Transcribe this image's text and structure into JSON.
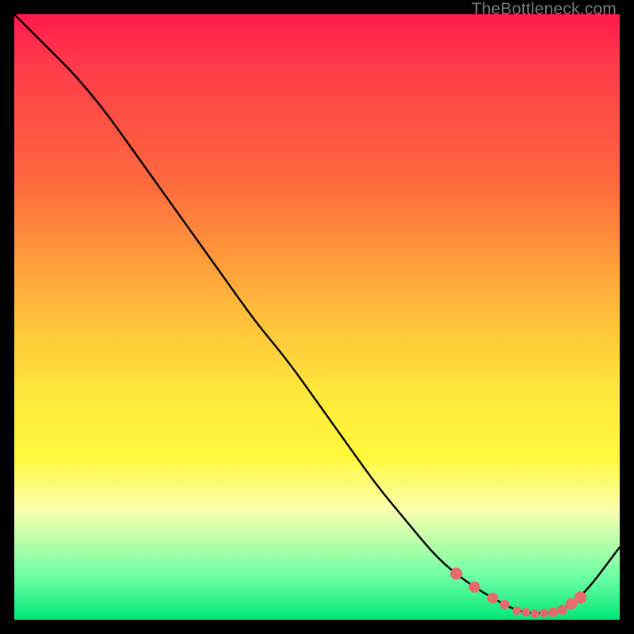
{
  "watermark": "TheBottleneck.com",
  "chart_data": {
    "type": "line",
    "title": "",
    "xlabel": "",
    "ylabel": "",
    "xlim": [
      0,
      100
    ],
    "ylim": [
      0,
      100
    ],
    "series": [
      {
        "name": "curve",
        "x": [
          0,
          6,
          10,
          15,
          20,
          25,
          30,
          35,
          40,
          45,
          50,
          55,
          60,
          65,
          70,
          75,
          80,
          83,
          86,
          90,
          94,
          100
        ],
        "y": [
          100,
          94,
          90,
          84,
          77,
          70,
          63,
          56,
          49,
          43,
          36,
          29,
          22,
          16,
          10,
          6,
          3,
          1.5,
          1,
          1.3,
          4,
          12
        ]
      }
    ],
    "markers": {
      "name": "highlight-dots",
      "color": "#e86b6b",
      "x": [
        73,
        76,
        79,
        81,
        83,
        84.5,
        86,
        87.5,
        89,
        90.5,
        92,
        93.5
      ],
      "r": [
        3.8,
        3.6,
        3.4,
        3.0,
        2.7,
        2.7,
        2.7,
        2.7,
        2.9,
        3.2,
        3.6,
        3.9
      ]
    }
  }
}
